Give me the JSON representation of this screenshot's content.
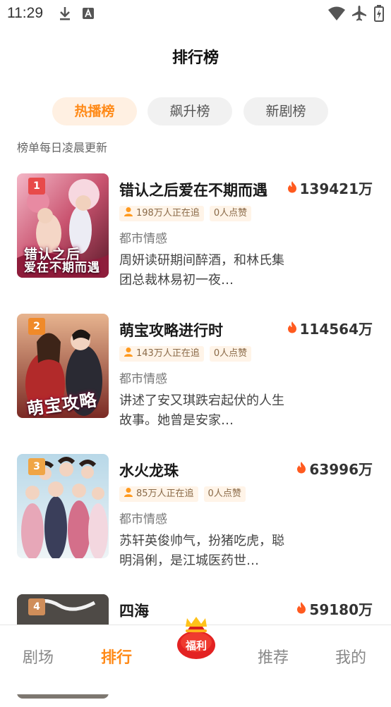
{
  "status_bar": {
    "time": "11:29"
  },
  "header": {
    "title": "排行榜"
  },
  "tabs": [
    {
      "label": "热播榜",
      "active": true
    },
    {
      "label": "飙升榜",
      "active": false
    },
    {
      "label": "新剧榜",
      "active": false
    }
  ],
  "update_note": "榜单每日凌晨更新",
  "items": [
    {
      "rank": "1",
      "title": "错认之后爱在不期而遇",
      "cover_title_1": "错认之后",
      "cover_title_2": "爱在不期而遇",
      "heat": "139421万",
      "followers": "198万人正在追",
      "likes": "0人点赞",
      "genre": "都市情感",
      "desc": "周妍读研期间醉酒，和林氏集团总裁林易初一夜…"
    },
    {
      "rank": "2",
      "title": "萌宝攻略进行时",
      "cover_title_1": "萌宝攻略",
      "cover_title_2": "",
      "heat": "114564万",
      "followers": "143万人正在追",
      "likes": "0人点赞",
      "genre": "都市情感",
      "desc": "讲述了安又琪跌宕起伏的人生故事。她曾是安家…"
    },
    {
      "rank": "3",
      "title": "水火龙珠",
      "cover_title_1": "",
      "cover_title_2": "",
      "heat": "63996万",
      "followers": "85万人正在追",
      "likes": "0人点赞",
      "genre": "都市情感",
      "desc": "苏轩英俊帅气，扮猪吃虎，聪明涓俐，是江城医药世…"
    },
    {
      "rank": "4",
      "title": "四海",
      "cover_title_1": "",
      "cover_title_2": "",
      "heat": "59180万"
    }
  ],
  "tabbar": {
    "items": [
      {
        "label": "剧场",
        "active": false
      },
      {
        "label": "排行",
        "active": true
      },
      {
        "label": "福利",
        "active": false
      },
      {
        "label": "推荐",
        "active": false
      },
      {
        "label": "我的",
        "active": false
      }
    ]
  },
  "colors": {
    "accent": "#ff8a18",
    "fire": "#ff5a1f",
    "tab_active_bg": "#fff0e2"
  },
  "icons": [
    "download-icon",
    "font-icon",
    "wifi-icon",
    "airplane-icon",
    "battery-icon",
    "fire-icon",
    "user-icon",
    "lucky-bag-icon"
  ]
}
